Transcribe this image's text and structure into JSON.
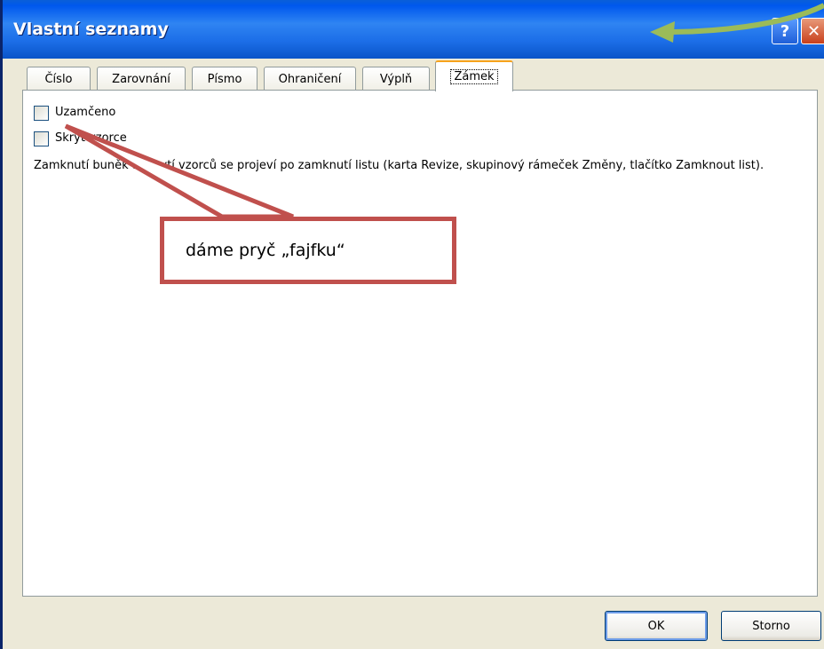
{
  "window": {
    "title": "Vlastní seznamy"
  },
  "titlebar_buttons": {
    "help": "?",
    "close": "✕"
  },
  "tabs": [
    {
      "label": "Číslo",
      "active": false
    },
    {
      "label": "Zarovnání",
      "active": false
    },
    {
      "label": "Písmo",
      "active": false
    },
    {
      "label": "Ohraničení",
      "active": false
    },
    {
      "label": "Výplň",
      "active": false
    },
    {
      "label": "Zámek",
      "active": true
    }
  ],
  "protection": {
    "locked": {
      "label": "Uzamčeno",
      "checked": false
    },
    "hidden": {
      "label": "Skrýt vzorce",
      "checked": false
    },
    "info": "Zamknutí buněk a skrytí vzorců se projeví po zamknutí listu (karta Revize, skupinový rámeček Změny, tlačítko Zamknout list)."
  },
  "buttons": {
    "ok": "OK",
    "cancel": "Storno"
  },
  "annotation": {
    "callout_text": "dáme pryč „fajfku“",
    "callout_color": "#c0504d",
    "arrow_color": "#9bbb59"
  }
}
